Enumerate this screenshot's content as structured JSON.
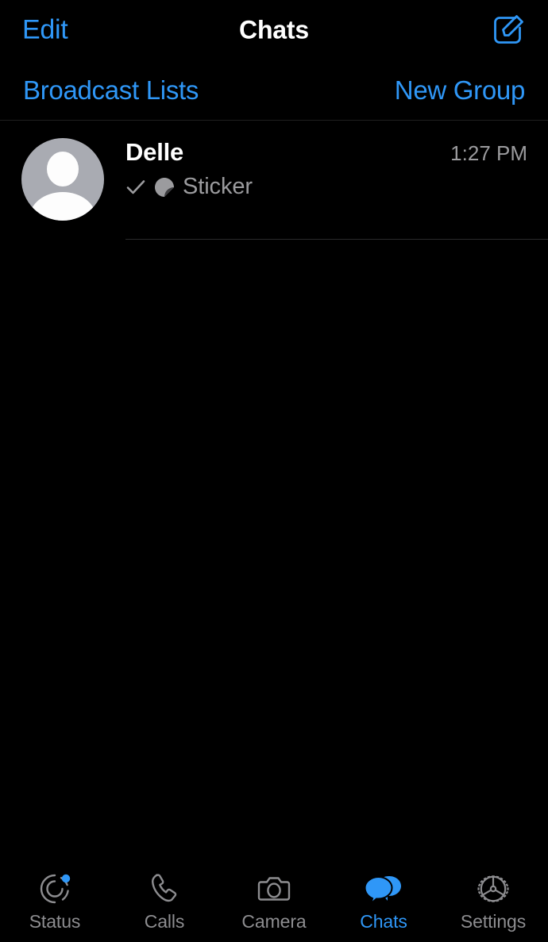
{
  "colors": {
    "background": "#000000",
    "accent_blue": "#2f97f7",
    "primary_text": "#ffffff",
    "secondary_text": "#9b9b9e",
    "tab_inactive": "#8d8d90",
    "separator": "#2a2a2c",
    "avatar_bg": "#a9abb2"
  },
  "navbar": {
    "left_button": "Edit",
    "title": "Chats",
    "right_icon_name": "compose-icon"
  },
  "subbar": {
    "broadcast_lists": "Broadcast Lists",
    "new_group": "New Group"
  },
  "chats": [
    {
      "name": "Delle",
      "time": "1:27 PM",
      "preview": "Sticker",
      "status_icon": "check-icon",
      "preview_icon": "sticker-icon",
      "avatar": "default-person-avatar"
    }
  ],
  "tabbar": {
    "items": [
      {
        "label": "Status",
        "icon": "status-ring-icon",
        "active": false,
        "badge": true
      },
      {
        "label": "Calls",
        "icon": "phone-icon",
        "active": false,
        "badge": false
      },
      {
        "label": "Camera",
        "icon": "camera-icon",
        "active": false,
        "badge": false
      },
      {
        "label": "Chats",
        "icon": "chat-bubbles-icon",
        "active": true,
        "badge": false
      },
      {
        "label": "Settings",
        "icon": "gear-icon",
        "active": false,
        "badge": false
      }
    ]
  }
}
